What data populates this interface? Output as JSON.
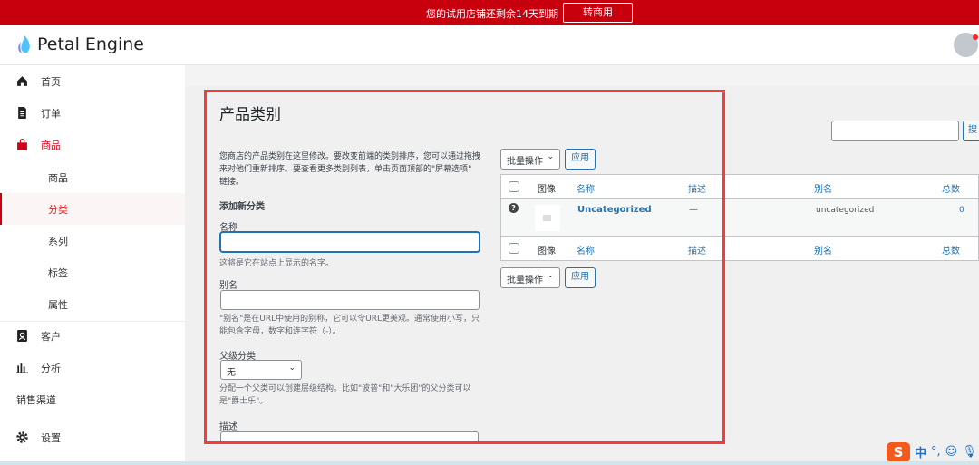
{
  "banner": {
    "message": "您的试用店铺还剩余14天到期",
    "button": "转商用"
  },
  "header": {
    "app_name": "Petal Engine"
  },
  "sidebar": {
    "items": [
      {
        "label": "首页",
        "icon": "home-icon"
      },
      {
        "label": "订单",
        "icon": "document-icon"
      },
      {
        "label": "商品",
        "icon": "shopping-bag-icon"
      },
      {
        "label": "商品"
      },
      {
        "label": "分类"
      },
      {
        "label": "系列"
      },
      {
        "label": "标签"
      },
      {
        "label": "属性"
      },
      {
        "label": "客户",
        "icon": "contact-icon"
      },
      {
        "label": "分析",
        "icon": "bar-chart-icon"
      },
      {
        "label": "销售渠道"
      },
      {
        "label": "设置",
        "icon": "gear-icon"
      }
    ]
  },
  "page": {
    "title": "产品类别",
    "intro": "您商店的产品类别在这里修改。要改变前端的类别排序，您可以通过拖拽来对他们重新排序。要查看更多类别列表，单击页面顶部的\"屏幕选项\" 链接。",
    "add_heading": "添加新分类",
    "name_label": "名称",
    "name_value": "",
    "name_help": "这将是它在站点上显示的名字。",
    "slug_label": "别名",
    "slug_value": "",
    "slug_help": "\"别名\"是在URL中使用的别称，它可以令URL更美观。通常使用小写，只能包含字母，数字和连字符（-）。",
    "parent_label": "父级分类",
    "parent_value": "无",
    "parent_help": "分配一个父类可以创建层级结构。比如\"波普\"和\"大乐团\"的父分类可以是\"爵士乐\"。",
    "desc_label": "描述"
  },
  "search": {
    "value": "",
    "button": "搜"
  },
  "bulk": {
    "label": "批量操作",
    "apply": "应用"
  },
  "table": {
    "headers": [
      "图像",
      "名称",
      "描述",
      "别名",
      "总数"
    ],
    "rows": [
      {
        "name": "Uncategorized",
        "description": "—",
        "slug": "uncategorized",
        "count": "0"
      }
    ]
  },
  "ime": {
    "mode": "中",
    "punct": "°,"
  }
}
